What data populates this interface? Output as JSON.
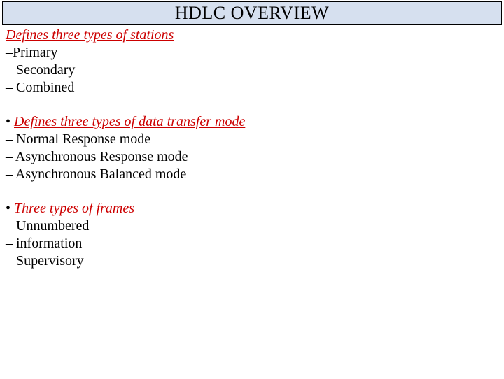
{
  "title": "HDLC OVERVIEW",
  "section1": {
    "heading": "Defines three types of stations",
    "items": [
      "–Primary",
      "– Secondary",
      "– Combined"
    ]
  },
  "section2": {
    "bullet": "•",
    "heading": "Defines three types of data transfer mode",
    "items": [
      " – Normal Response mode",
      "– Asynchronous Response mode",
      "– Asynchronous Balanced mode"
    ]
  },
  "section3": {
    "bullet": "•",
    "heading": "Three types of frames",
    "items": [
      "– Unnumbered",
      "– information",
      " – Supervisory"
    ]
  }
}
